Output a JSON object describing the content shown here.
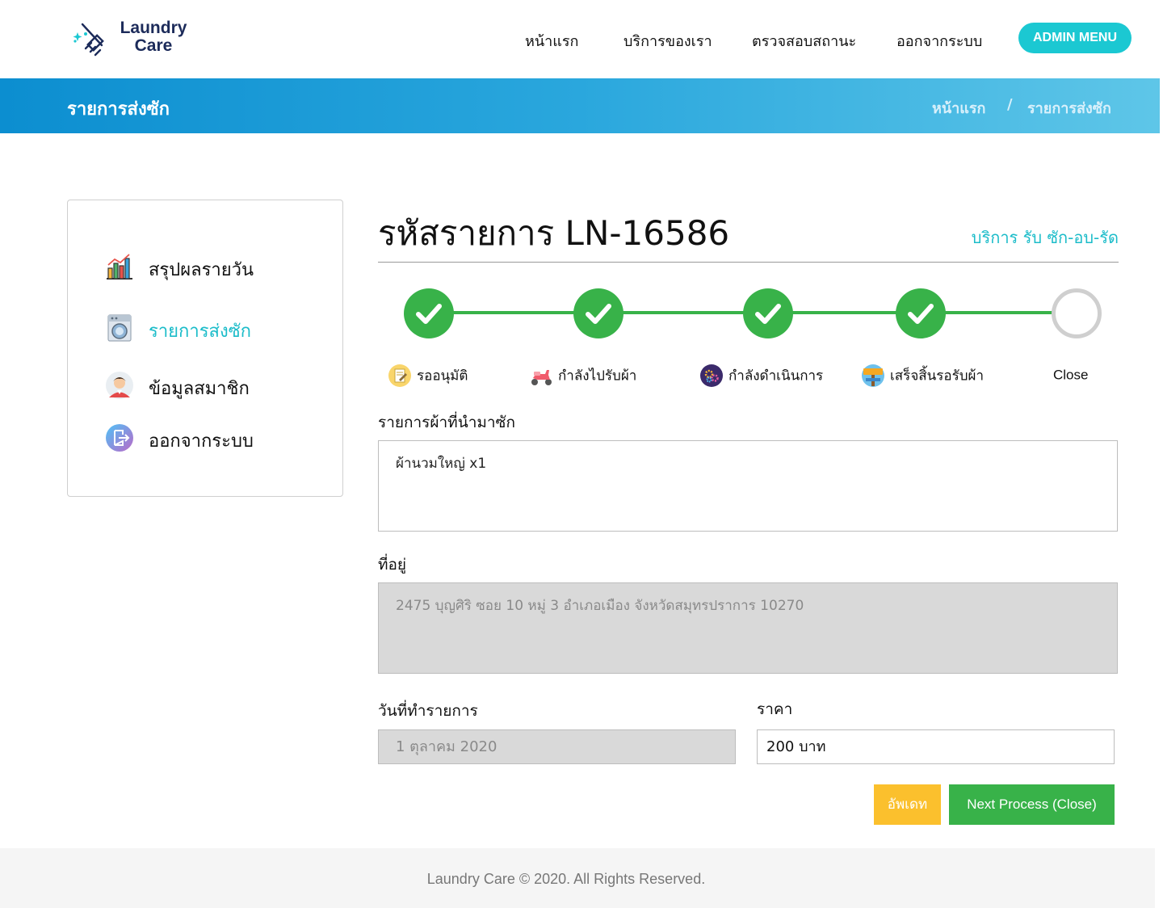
{
  "brand": {
    "line1": "Laundry",
    "line2": "Care"
  },
  "nav": {
    "home": "หน้าแรก",
    "services": "บริการของเรา",
    "status": "ตรวจสอบสถานะ",
    "logout": "ออกจากระบบ",
    "admin": "ADMIN MENU"
  },
  "banner": {
    "title": "รายการส่งซัก",
    "crumb_home": "หน้าแรก",
    "crumb_sep": "/",
    "crumb_current": "รายการส่งซัก"
  },
  "sidebar": {
    "items": [
      {
        "label": "สรุปผลรายวัน",
        "icon": "bar-chart-icon"
      },
      {
        "label": "รายการส่งซัก",
        "icon": "washing-machine-icon",
        "active": true
      },
      {
        "label": "ข้อมูลสมาชิก",
        "icon": "member-avatar-icon"
      },
      {
        "label": "ออกจากระบบ",
        "icon": "logout-icon"
      }
    ]
  },
  "order": {
    "title": "รหัสรายการ LN-16586",
    "service": "บริการ รับ ซัก-อบ-รัด"
  },
  "steps": [
    {
      "label": "รออนุมัติ",
      "status": "done",
      "icon": "document-icon"
    },
    {
      "label": "กำลังไปรับผ้า",
      "status": "done",
      "icon": "scooter-icon"
    },
    {
      "label": "กำลังดำเนินการ",
      "status": "done",
      "icon": "gears-icon"
    },
    {
      "label": "เสร็จสิ้นรอรับผ้า",
      "status": "done",
      "icon": "success-sign-icon"
    },
    {
      "label": "Close",
      "status": "pending"
    }
  ],
  "form": {
    "items_label": "รายการผ้าที่นำมาซัก",
    "items_value": "ผ้านวมใหญ่ x1",
    "address_label": "ที่อยู่",
    "address_value": "2475 บุญศิริ ซอย 10 หมู่ 3 อำเภอเมือง จังหวัดสมุทรปราการ 10270",
    "date_label": "วันที่ทำรายการ",
    "date_value": "1 ตุลาคม 2020",
    "price_label": "ราคา",
    "price_value": "200 บาท"
  },
  "buttons": {
    "update": "อัพเดท",
    "next": "Next Process (Close)"
  },
  "footer": "Laundry Care © 2020. All Rights Reserved.",
  "colors": {
    "accent": "#1bc8d2",
    "banner_start": "#0c8ed0",
    "banner_end": "#5ec6e8",
    "success": "#38b249",
    "warning": "#fbc02d"
  }
}
